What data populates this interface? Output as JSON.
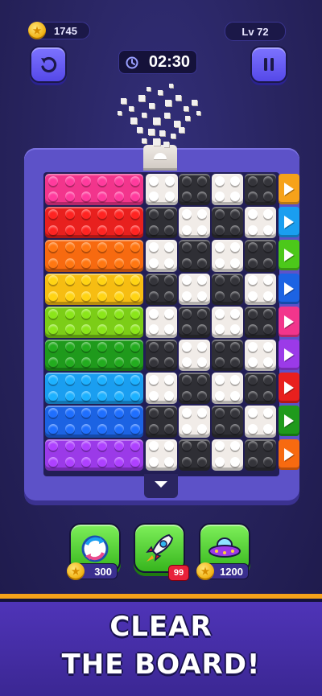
{
  "hud": {
    "coins": "1745",
    "level": "Lv 72",
    "timer": "02:30",
    "undo_icon": "undo-icon",
    "pause_icon": "pause-icon",
    "clock_icon": "clock-icon"
  },
  "board": {
    "colored_rows": [
      "#f2358c",
      "#e8201e",
      "#f76a10",
      "#f6bd12",
      "#7ccd17",
      "#1f9a1c",
      "#1a9ef0",
      "#1c63e3",
      "#9b3ae8"
    ],
    "arrow_colors": [
      "#f6a21a",
      "#1a9ef0",
      "#4cc81a",
      "#1c63e3",
      "#f2358c",
      "#9b3ae8",
      "#e8201e",
      "#1f9a1c",
      "#f76a10"
    ],
    "checker_white": "#f1ece8",
    "checker_black": "#2f2f35"
  },
  "boosters": [
    {
      "name": "swap-booster",
      "icon": "swap-icon",
      "price": "300"
    },
    {
      "name": "rocket-booster",
      "icon": "rocket-icon",
      "count": "99"
    },
    {
      "name": "ufo-booster",
      "icon": "ufo-icon",
      "price": "1200"
    }
  ],
  "banner": {
    "line1": "CLEAR",
    "line2": "THE BOARD!"
  }
}
